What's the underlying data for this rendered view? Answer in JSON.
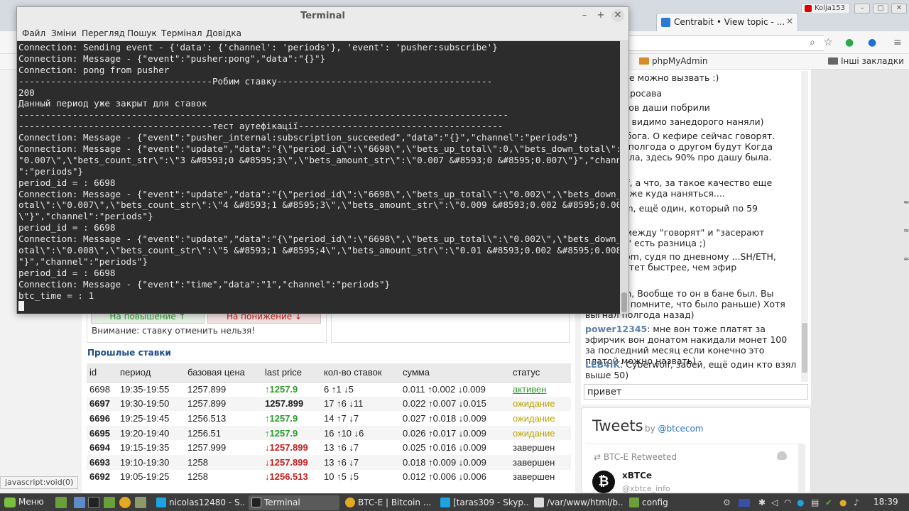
{
  "browser": {
    "tabs": [
      {
        "label": "Centrabit • View topic - ..."
      }
    ],
    "user_badge": "Kolja153",
    "bookmarks": [
      "phpMyAdmin",
      "Інші закладки"
    ],
    "status_url": "javascript:void(0)"
  },
  "betting": {
    "btn_up": "На повышение ↑",
    "btn_down": "На понижение ↓",
    "warning": "Внимание: ставку отменить нельзя!",
    "past_title": "Прошлые ставки",
    "columns": [
      "id",
      "период",
      "базовая цена",
      "last price",
      "кол-во ставок",
      "сумма",
      "статус"
    ],
    "rows": [
      {
        "id": "6698",
        "period": "19:35-19:55",
        "base": "1257.899",
        "last": "↑1257.9",
        "count": "6 ↑1 ↓5",
        "sum": "0.011 ↑0.002 ↓0.009",
        "status": "активен"
      },
      {
        "id": "6697",
        "period": "19:30-19:50",
        "base": "1257.899",
        "last": "1257.899",
        "count": "17 ↑6 ↓11",
        "sum": "0.022 ↑0.007 ↓0.015",
        "status": "ожидание"
      },
      {
        "id": "6696",
        "period": "19:25-19:45",
        "base": "1256.513",
        "last": "↑1257.9",
        "count": "14 ↑7 ↓7",
        "sum": "0.027 ↑0.018 ↓0.009",
        "status": "ожидание"
      },
      {
        "id": "6695",
        "period": "19:20-19:40",
        "base": "1256.51",
        "last": "↑1257.9",
        "count": "16 ↑10 ↓6",
        "sum": "0.026 ↑0.017 ↓0.009",
        "status": "ожидание"
      },
      {
        "id": "6694",
        "period": "19:15-19:35",
        "base": "1257.999",
        "last": "↓1257.899",
        "count": "13 ↑6 ↓7",
        "sum": "0.025 ↑0.016 ↓0.009",
        "status": "завершен"
      },
      {
        "id": "6693",
        "period": "19:10-19:30",
        "base": "1258",
        "last": "↓1257.899",
        "count": "13 ↑6 ↓7",
        "sum": "0.018 ↑0.009 ↓0.009",
        "status": "завершен"
      },
      {
        "id": "6692",
        "period": "19:05-19:25",
        "base": "1258",
        "last": "↓1256.513",
        "count": "10 ↑5 ↓5",
        "sum": "0.012 ↑0.006 ↓0.006",
        "status": "завершен"
      }
    ]
  },
  "chat": {
    "messages": [
      {
        "nick": "",
        "text": "вообще не можно вызвать :)"
      },
      {
        "nick": "",
        "text": ": Кефир кросава"
      },
      {
        "nick": "",
        "text": ": а фанатов даши побрили"
      },
      {
        "nick": "",
        "text": ": kazyabr, видимо занедорого наняли)"
      },
      {
        "nick": "",
        "text": "Да ради бога. О кефире сейчас говорят. Пройдет полгода о другом будут Когда даша росла, здесь 90% про дашу была."
      },
      {
        "nick": "",
        "text": "Cyberwolf, а что, за такое качество еще может тоже куда наняться...."
      },
      {
        "nick": "",
        "text": "wickedrom, ещё один, который по 59"
      },
      {
        "nick": "",
        "text": "er0man, между \"говорят\" и \"засерают ...рогами\" есть разница ;)"
      },
      {
        "nick": "",
        "text": ": wickedrom, судя по дневному ...SH/ETH, даша растет быстрее, чем эфир"
      },
      {
        "nick": "",
        "text": ": Zer0man, Вообще то он в бане был. Вы видно не помните, что было раньше) Хотя выгнал полгода назад)"
      },
      {
        "nick": "power12345",
        "text": ": мне вон тоже платят за эфирчик вон донатом накидали монет 100 за последний месяц если конечно это платой можно назвать)"
      },
      {
        "nick": "LEB4IK",
        "text": ": Cyberwolf, забей, ещё один кто взял выше 50)"
      }
    ],
    "input_value": "привет"
  },
  "tweets": {
    "title": "Tweets",
    "by_prefix": "by",
    "by_handle": "@btcecom",
    "retweet_line": "BTC-E Retweeted",
    "user": "xBTCe",
    "handle": "@xbtce_info"
  },
  "terminal": {
    "title": "Terminal",
    "menu": [
      "Файл",
      "Зміни",
      "Перегляд",
      "Пошук",
      "Термінал",
      "Довідка"
    ],
    "lines": [
      "Connection: Sending event - {'data': {'channel': 'periods'}, 'event': 'pusher:subscribe'}",
      "Connection: Message - {\"event\":\"pusher:pong\",\"data\":\"{}\"}",
      "Connection: pong from pusher",
      "------------------------------------Робим ставку----------------------------------------",
      "200",
      "Данный период уже закрыт для ставок",
      "-------------------------------------------------------------------------------------------",
      "------------------------------------тест аутефікації--------------------------------------",
      "Connection: Message - {\"event\":\"pusher_internal:subscription_succeeded\",\"data\":\"{}\",\"channel\":\"periods\"}",
      "Connection: Message - {\"event\":\"update\",\"data\":\"{\\\"period_id\\\":\\\"6698\\\",\\\"bets_up_total\\\":0,\\\"bets_down_total\\\":\\",
      "\"0.007\\\",\\\"bets_count_str\\\":\\\"3 &#8593;0 &#8595;3\\\",\\\"bets_amount_str\\\":\\\"0.007 &#8593;0 &#8595;0.007\\\"}\",\"channel",
      "\":\"periods\"}",
      "period_id = : 6698",
      "Connection: Message - {\"event\":\"update\",\"data\":\"{\\\"period_id\\\":\\\"6698\\\",\\\"bets_up_total\\\":\\\"0.002\\\",\\\"bets_down_t",
      "otal\\\":\\\"0.007\\\",\\\"bets_count_str\\\":\\\"4 &#8593;1 &#8595;3\\\",\\\"bets_amount_str\\\":\\\"0.009 &#8593;0.002 &#8595;0.007",
      "\\\"}\",\"channel\":\"periods\"}",
      "period_id = : 6698",
      "Connection: Message - {\"event\":\"update\",\"data\":\"{\\\"period_id\\\":\\\"6698\\\",\\\"bets_up_total\\\":\\\"0.002\\\",\\\"bets_down_t",
      "otal\\\":\\\"0.008\\\",\\\"bets_count_str\\\":\\\"5 &#8593;1 &#8595;4\\\",\\\"bets_amount_str\\\":\\\"0.01 &#8593;0.002 &#8595;0.008\\",
      "\"}\",\"channel\":\"periods\"}",
      "period_id = : 6698",
      "Connection: Message - {\"event\":\"time\",\"data\":\"1\",\"channel\":\"periods\"}",
      "btc_time = : 1"
    ]
  },
  "taskbar": {
    "start_label": "Меню",
    "tasks": [
      "nicolas12480 - S...",
      "Terminal",
      "BTC-E | Bitcoin ...",
      "[taras309 - Skyp...",
      "/var/www/html/b...",
      "config"
    ],
    "clock": "18:39"
  },
  "colors": {
    "terminal_bg": "#2c2c2c",
    "terminal_fg": "#e8e8e8",
    "up_green": "#2e9c2e",
    "down_red": "#c42020",
    "waiting_yellow": "#b8a600",
    "link_blue": "#1c4b8a"
  }
}
